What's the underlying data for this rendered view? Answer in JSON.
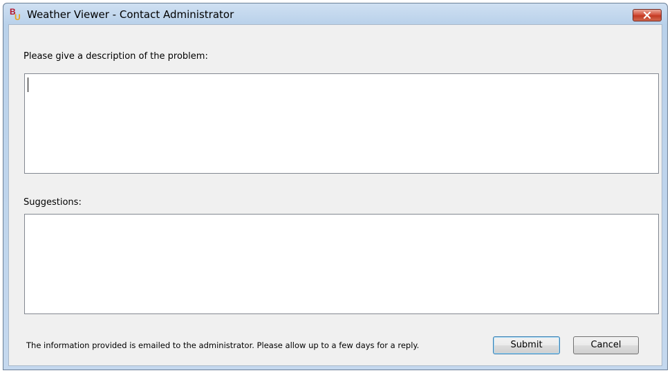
{
  "window": {
    "title": "Weather Viewer - Contact Administrator",
    "logo_letters": [
      "B",
      "U"
    ],
    "close_icon": "close-icon"
  },
  "form": {
    "description_label": "Please give a description of the problem:",
    "description_value": "",
    "suggestions_label": "Suggestions:",
    "suggestions_value": ""
  },
  "footer": {
    "info_text": "The information provided is emailed to the administrator.  Please allow up to a few days for a reply.",
    "submit_label": "Submit",
    "cancel_label": "Cancel"
  },
  "colors": {
    "logo_red": "#b3122a",
    "logo_gold": "#e8a21a",
    "close_red": "#c23a23",
    "titlebar": "#c4d8ee",
    "client_bg": "#f0f0f0"
  }
}
